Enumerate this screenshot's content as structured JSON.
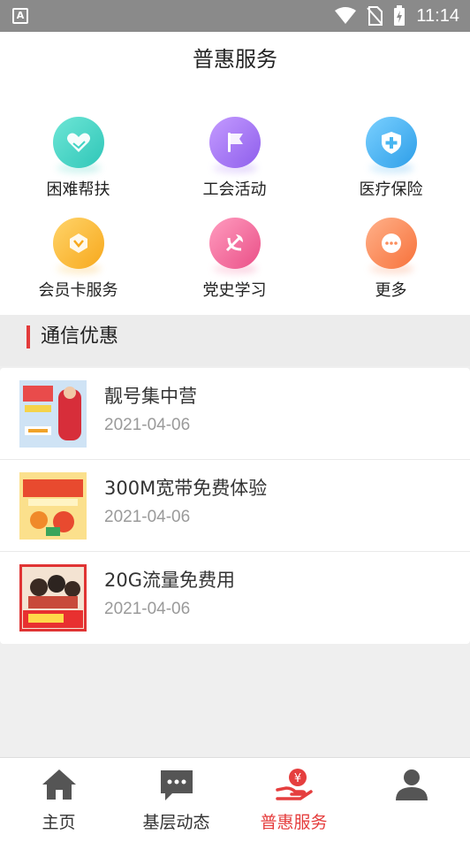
{
  "status_bar": {
    "time": "11:14",
    "left_icon_letter": "A"
  },
  "header": {
    "title": "普惠服务"
  },
  "services": [
    {
      "label": "困难帮扶",
      "icon": "heart-hand-icon",
      "color": "#3fd3c4"
    },
    {
      "label": "工会活动",
      "icon": "flag-icon",
      "color": "#a97bf2"
    },
    {
      "label": "医疗保险",
      "icon": "medical-shield-icon",
      "color": "#47b6f1"
    },
    {
      "label": "会员卡服务",
      "icon": "member-card-icon",
      "color": "#fbbd3a"
    },
    {
      "label": "党史学习",
      "icon": "party-emblem-icon",
      "color": "#f2739d"
    },
    {
      "label": "更多",
      "icon": "more-icon",
      "color": "#fb8e5d"
    }
  ],
  "section": {
    "title": "通信优惠"
  },
  "articles": [
    {
      "title": "靓号集中营",
      "date": "2021-04-06"
    },
    {
      "title": "300M宽带免费体验",
      "date": "2021-04-06"
    },
    {
      "title": "20G流量免费用",
      "date": "2021-04-06"
    }
  ],
  "tabs": [
    {
      "label": "主页",
      "icon": "home-icon",
      "active": false
    },
    {
      "label": "基层动态",
      "icon": "chat-bubble-icon",
      "active": false
    },
    {
      "label": "普惠服务",
      "icon": "hand-coin-icon",
      "active": true
    },
    {
      "label": "",
      "icon": "user-icon",
      "active": false
    }
  ],
  "colors": {
    "accent": "#e53e3e",
    "status_bar": "#8a8a8a"
  }
}
